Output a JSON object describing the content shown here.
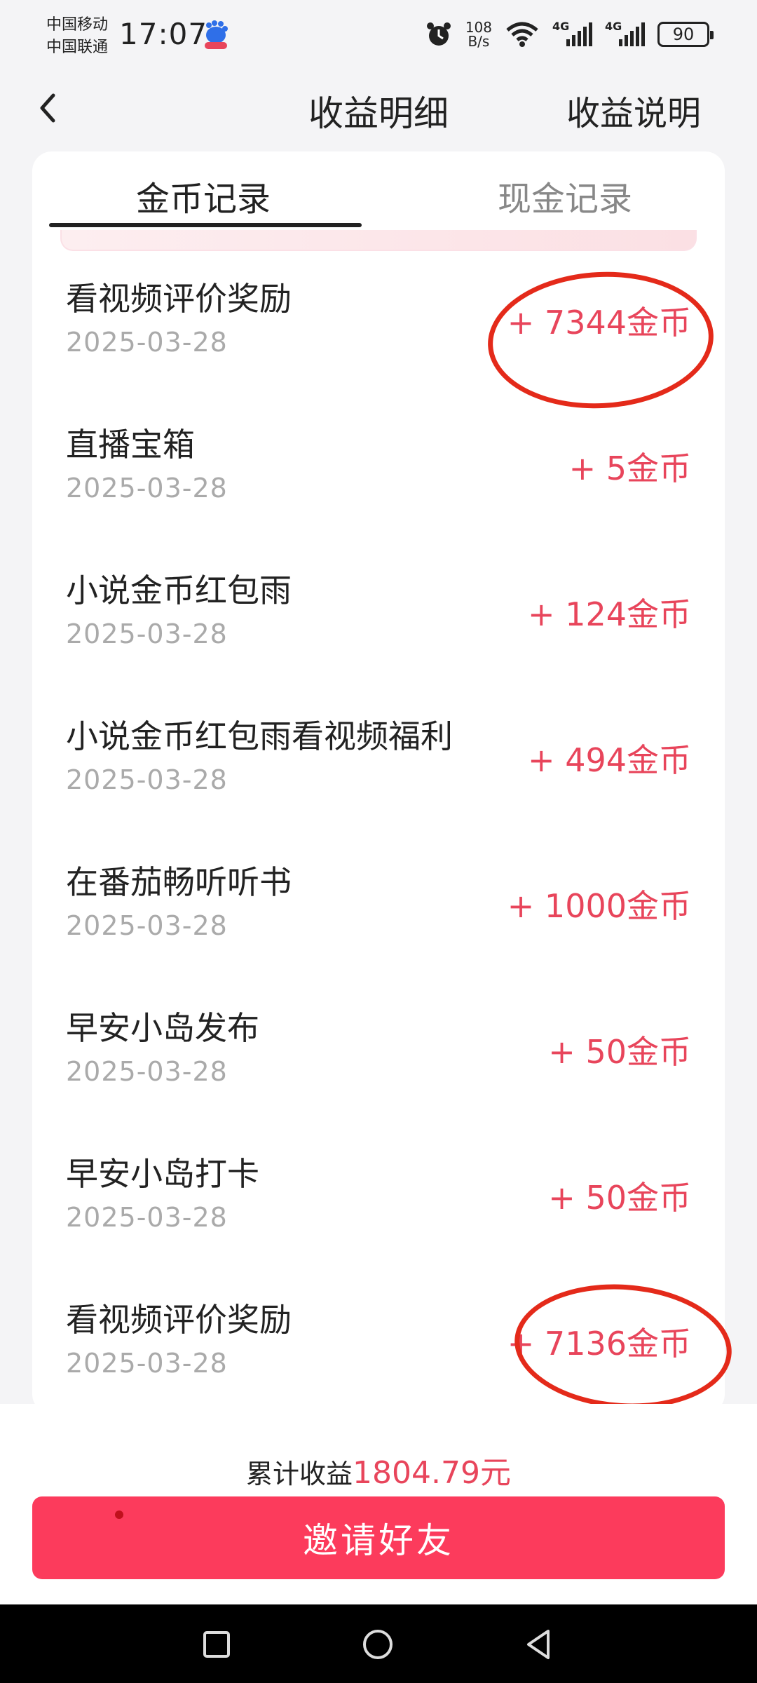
{
  "status_bar": {
    "carrier1": "中国移动",
    "carrier2": "中国联通",
    "time": "17:07",
    "net_speed_value": "108",
    "net_speed_unit": "B/s",
    "signal1": "4G",
    "signal2": "4G",
    "battery": "90"
  },
  "header": {
    "title": "收益明细",
    "help_link": "收益说明"
  },
  "tabs": [
    {
      "label": "金币记录"
    },
    {
      "label": "现金记录"
    }
  ],
  "records": [
    {
      "title": "看视频评价奖励",
      "date": "2025-03-28",
      "amount": "+ 7344金币"
    },
    {
      "title": "直播宝箱",
      "date": "2025-03-28",
      "amount": "+ 5金币"
    },
    {
      "title": "小说金币红包雨",
      "date": "2025-03-28",
      "amount": "+ 124金币"
    },
    {
      "title": "小说金币红包雨看视频福利",
      "date": "2025-03-28",
      "amount": "+ 494金币"
    },
    {
      "title": "在番茄畅听听书",
      "date": "2025-03-28",
      "amount": "+ 1000金币"
    },
    {
      "title": "早安小岛发布",
      "date": "2025-03-28",
      "amount": "+ 50金币"
    },
    {
      "title": "早安小岛打卡",
      "date": "2025-03-28",
      "amount": "+ 50金币"
    },
    {
      "title": "看视频评价奖励",
      "date": "2025-03-28",
      "amount": "+ 7136金币"
    }
  ],
  "footer": {
    "total_label": "累计收益",
    "total_amount": "1804.79元",
    "invite_button": "邀请好友"
  },
  "colors": {
    "accent": "#fc3b5c",
    "amount_text": "#e8455b",
    "annotation_circle": "#e42a1a"
  }
}
